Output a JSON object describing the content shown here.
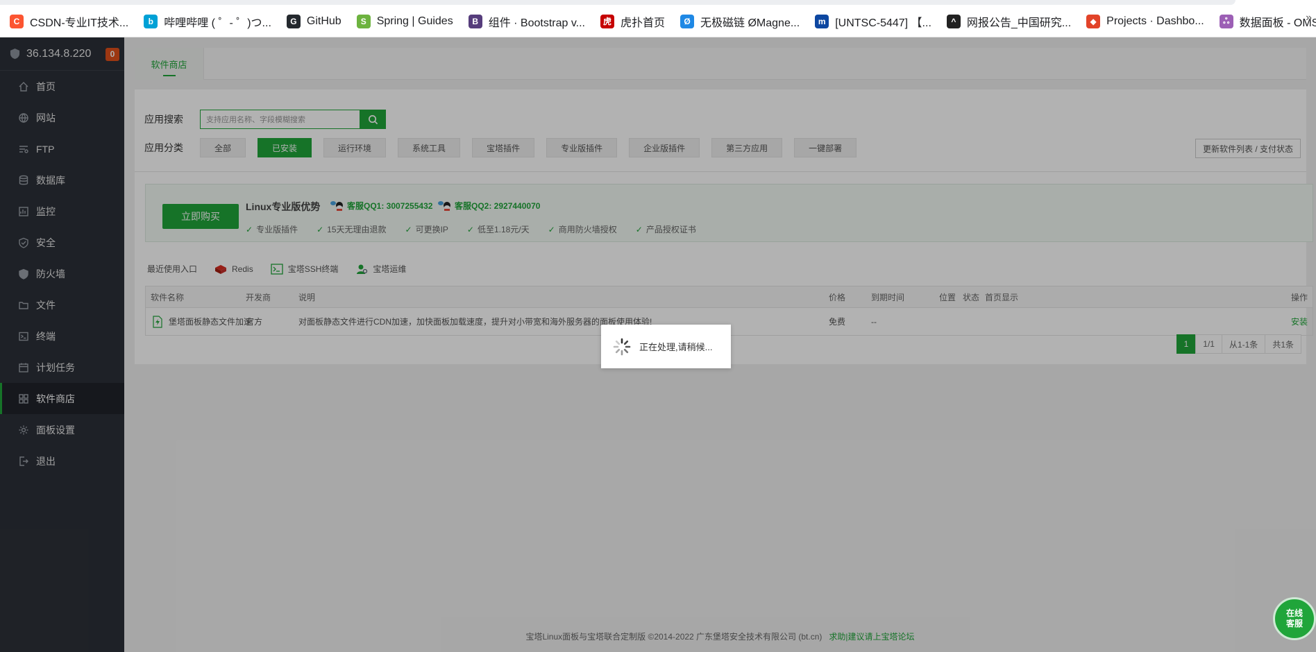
{
  "bookmarks": [
    {
      "label": "CSDN-专业IT技术...",
      "icon": "csdn-icon",
      "color": "#fc5531",
      "glyph": "C"
    },
    {
      "label": "哔哩哔哩 ( ゜- ゜)つ...",
      "icon": "bilibili-icon",
      "color": "#00a1d6",
      "glyph": "b"
    },
    {
      "label": "GitHub",
      "icon": "github-icon",
      "color": "#24292e",
      "glyph": "G"
    },
    {
      "label": "Spring | Guides",
      "icon": "spring-icon",
      "color": "#6db33f",
      "glyph": "S"
    },
    {
      "label": "组件 · Bootstrap v...",
      "icon": "bootstrap-icon",
      "color": "#563d7c",
      "glyph": "B"
    },
    {
      "label": "虎扑首页",
      "icon": "hupu-icon",
      "color": "#c60100",
      "glyph": "虎"
    },
    {
      "label": "无极磁链 ØMagne...",
      "icon": "magnet-icon",
      "color": "#1e88e5",
      "glyph": "Ø"
    },
    {
      "label": "[UNTSC-5447] 【...",
      "icon": "jira-icon",
      "color": "#0d47a1",
      "glyph": "m"
    },
    {
      "label": "网报公告_中国研究...",
      "icon": "graduation-icon",
      "color": "#222222",
      "glyph": "^"
    },
    {
      "label": "Projects · Dashbo...",
      "icon": "gitlab-icon",
      "color": "#e24329",
      "glyph": "◆"
    },
    {
      "label": "数据面板 - OMS",
      "icon": "octopus-icon",
      "color": "#9c5fb5",
      "glyph": "ஃ"
    }
  ],
  "bookmarks_more": "»",
  "sidebar": {
    "server_ip": "36.134.8.220",
    "badge": "0",
    "items": [
      {
        "label": "首页",
        "icon": "home-icon",
        "active": false
      },
      {
        "label": "网站",
        "icon": "globe-icon",
        "active": false
      },
      {
        "label": "FTP",
        "icon": "ftp-icon",
        "active": false
      },
      {
        "label": "数据库",
        "icon": "database-icon",
        "active": false
      },
      {
        "label": "监控",
        "icon": "monitor-icon",
        "active": false
      },
      {
        "label": "安全",
        "icon": "shield-check-icon",
        "active": false
      },
      {
        "label": "防火墙",
        "icon": "firewall-icon",
        "active": false
      },
      {
        "label": "文件",
        "icon": "folder-icon",
        "active": false
      },
      {
        "label": "终端",
        "icon": "terminal-icon",
        "active": false
      },
      {
        "label": "计划任务",
        "icon": "calendar-icon",
        "active": false
      },
      {
        "label": "软件商店",
        "icon": "grid-icon",
        "active": true
      },
      {
        "label": "面板设置",
        "icon": "gear-icon",
        "active": false
      },
      {
        "label": "退出",
        "icon": "logout-icon",
        "active": false
      }
    ]
  },
  "main": {
    "tab_label": "软件商店",
    "search_label": "应用搜索",
    "search_placeholder": "支持应用名称、字段模糊搜索",
    "category_label": "应用分类",
    "categories": [
      "全部",
      "已安装",
      "运行环境",
      "系统工具",
      "宝塔插件",
      "专业版插件",
      "企业版插件",
      "第三方应用",
      "一键部署"
    ],
    "active_category": "已安装",
    "refresh_label": "更新软件列表 / 支付状态",
    "promo": {
      "buy_label": "立即购买",
      "title": "Linux专业版优势",
      "qq1": "客服QQ1: 3007255432",
      "qq2": "客服QQ2: 2927440070",
      "features": [
        "专业版插件",
        "15天无理由退款",
        "可更换IP",
        "低至1.18元/天",
        "商用防火墙授权",
        "产品授权证书"
      ]
    },
    "recent": {
      "label": "最近使用入口",
      "items": [
        "Redis",
        "宝塔SSH终端",
        "宝塔运维"
      ]
    },
    "table": {
      "headers": [
        "软件名称",
        "开发商",
        "说明",
        "价格",
        "到期时间",
        "位置",
        "状态",
        "首页显示",
        "操作"
      ],
      "rows": [
        {
          "name": "堡塔面板静态文件加速",
          "dev": "官方",
          "desc": "对面板静态文件进行CDN加速，加快面板加载速度，提升对小带宽和海外服务器的面板使用体验!",
          "price": "免费",
          "expire": "--",
          "action": "安装"
        }
      ]
    },
    "pager": {
      "current": "1",
      "total_pages": "1/1",
      "range": "从1-1条",
      "total": "共1条"
    },
    "footer": {
      "copyright": "宝塔Linux面板与宝塔联合定制版 ©2014-2022 广东堡塔安全技术有限公司 (bt.cn)",
      "link": "求助|建议请上宝塔论坛"
    }
  },
  "loading_text": "正在处理,请稍候...",
  "service_label": "在线\n客服",
  "colors": {
    "accent": "#20a53a",
    "sidebar": "#2c3038",
    "badge": "#e0501a"
  }
}
